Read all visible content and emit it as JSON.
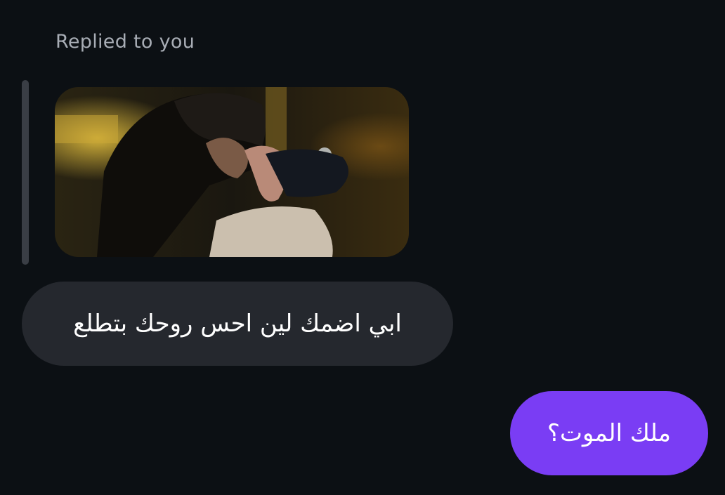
{
  "reply": {
    "label": "Replied to you"
  },
  "messages": {
    "incoming": {
      "text": "ابي اضمك لين احس روحك بتطلع"
    },
    "outgoing": {
      "text": "ملك الموت؟"
    }
  },
  "colors": {
    "background": "#0c1014",
    "incoming_bubble": "#25282e",
    "outgoing_bubble": "#7a3df4",
    "reply_bar": "#3a3e45",
    "label_text": "#a8adb5"
  }
}
